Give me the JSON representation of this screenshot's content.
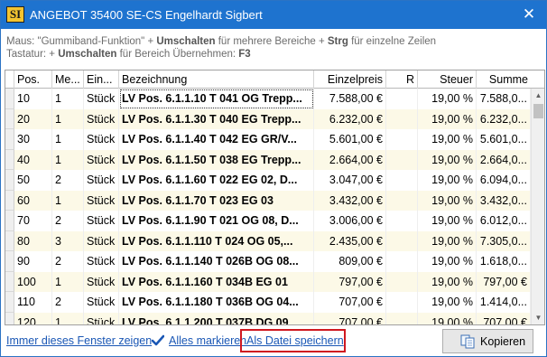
{
  "window": {
    "title": "ANGEBOT 35400 SE-CS Engelhardt Sigbert",
    "app_icon_text": "SI",
    "close_icon": "close-icon",
    "accent_color": "#1e73cf"
  },
  "hints": {
    "line1_pre": "Maus: \"Gummiband-Funktion\" + ",
    "line1_key1": "Umschalten",
    "line1_mid": " für mehrere Bereiche + ",
    "line1_key2": "Strg",
    "line1_post": " für einzelne Zeilen",
    "line2_pre": "Tastatur: + ",
    "line2_key1": "Umschalten",
    "line2_mid": " für Bereich   Übernehmen: ",
    "line2_key2": "F3"
  },
  "table": {
    "columns": [
      "Pos.",
      "Me...",
      "Ein...",
      "Bezeichnung",
      "Einzelpreis",
      "R",
      "Steuer",
      "Summe"
    ],
    "rows": [
      [
        "10",
        "1",
        "Stück",
        "LV Pos. 6.1.1.10 T 041 OG Trepp...",
        "7.588,00 €",
        "",
        "19,00 %",
        "7.588,0..."
      ],
      [
        "20",
        "1",
        "Stück",
        "LV Pos. 6.1.1.30 T 040 EG Trepp...",
        "6.232,00 €",
        "",
        "19,00 %",
        "6.232,0..."
      ],
      [
        "30",
        "1",
        "Stück",
        "LV Pos. 6.1.1.40 T 042 EG GR/V...",
        "5.601,00 €",
        "",
        "19,00 %",
        "5.601,0..."
      ],
      [
        "40",
        "1",
        "Stück",
        "LV Pos. 6.1.1.50 T 038 EG Trepp...",
        "2.664,00 €",
        "",
        "19,00 %",
        "2.664,0..."
      ],
      [
        "50",
        "2",
        "Stück",
        "LV Pos. 6.1.1.60 T 022 EG 02, D...",
        "3.047,00 €",
        "",
        "19,00 %",
        "6.094,0..."
      ],
      [
        "60",
        "1",
        "Stück",
        "LV Pos. 6.1.1.70 T 023 EG 03",
        "3.432,00 €",
        "",
        "19,00 %",
        "3.432,0..."
      ],
      [
        "70",
        "2",
        "Stück",
        "LV Pos. 6.1.1.90 T 021 OG 08, D...",
        "3.006,00 €",
        "",
        "19,00 %",
        "6.012,0..."
      ],
      [
        "80",
        "3",
        "Stück",
        "LV Pos. 6.1.1.110 T 024 OG 05,...",
        "2.435,00 €",
        "",
        "19,00 %",
        "7.305,0..."
      ],
      [
        "90",
        "2",
        "Stück",
        "LV Pos. 6.1.1.140 T 026B OG 08...",
        "809,00 €",
        "",
        "19,00 %",
        "1.618,0..."
      ],
      [
        "100",
        "1",
        "Stück",
        "LV Pos. 6.1.1.160 T 034B EG 01",
        "797,00 €",
        "",
        "19,00 %",
        "797,00 €"
      ],
      [
        "110",
        "2",
        "Stück",
        "LV Pos. 6.1.1.180 T 036B OG 04...",
        "707,00 €",
        "",
        "19,00 %",
        "1.414,0..."
      ],
      [
        "120",
        "1",
        "Stück",
        "LV Pos. 6.1.1.200 T 037B DG 09",
        "707,00 €",
        "",
        "19,00 %",
        "707,00 €"
      ]
    ],
    "row_stripe_color": "#fcf9e7"
  },
  "footer": {
    "link_window": "Immer dieses Fenster zeigen",
    "check_icon": "checkmark-icon",
    "link_mark_all": "Alles markieren",
    "link_save_file": "Als Datei speichern",
    "highlight_color": "#d01820",
    "copy_button": "Kopieren",
    "copy_icon": "copy-icon"
  }
}
